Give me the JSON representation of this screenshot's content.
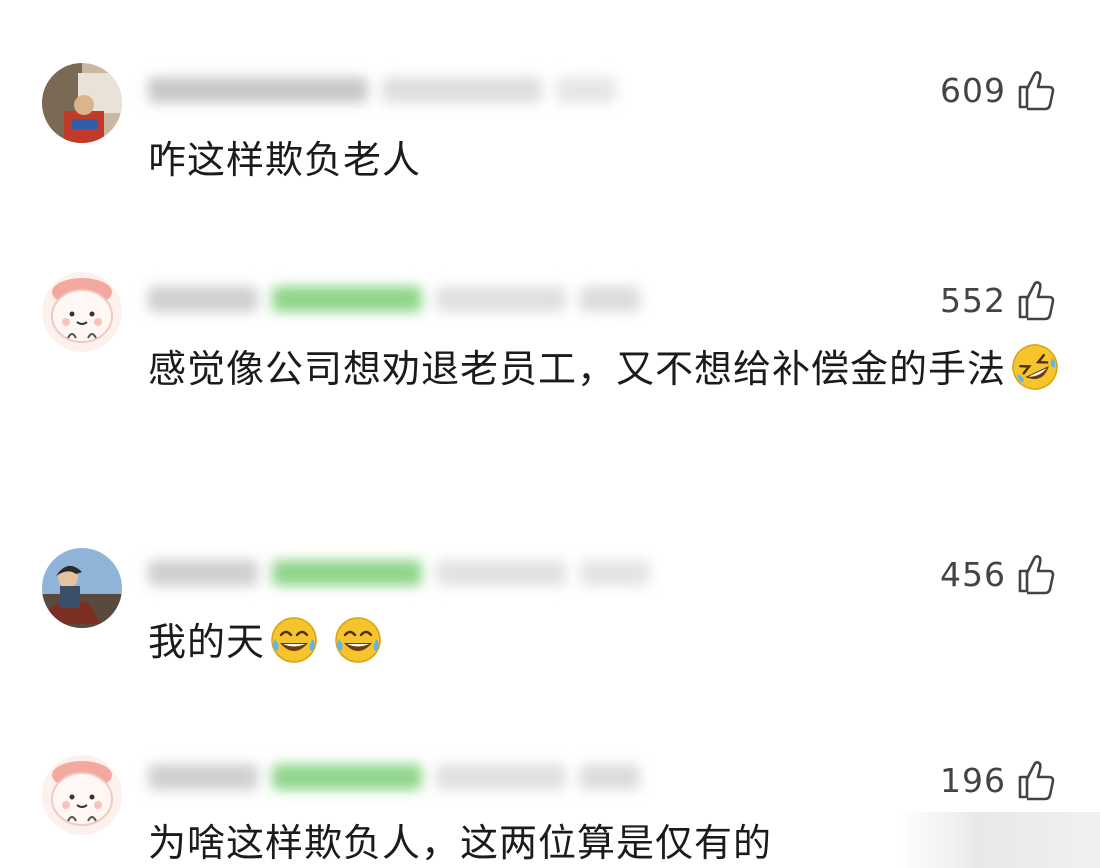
{
  "comments": [
    {
      "likes": "609",
      "text": "咋这样欺负老人",
      "avatar": "photo-avatar",
      "emojis": []
    },
    {
      "likes": "552",
      "text": "感觉像公司想劝退老员工，又不想给补偿金的手法",
      "avatar": "cartoon-bun-avatar",
      "emojis": [
        "rolling-laugh-emoji"
      ]
    },
    {
      "likes": "456",
      "text": "我的天",
      "avatar": "illustration-avatar",
      "emojis": [
        "tears-of-joy-emoji",
        "tears-of-joy-emoji"
      ]
    },
    {
      "likes": "196",
      "text": "为啥这样欺负人，这两位算是仅有的",
      "avatar": "cartoon-bun-avatar",
      "emojis": []
    }
  ],
  "icons": {
    "like": "thumbs-up-icon"
  },
  "colors": {
    "background": "#ffffff",
    "like_text": "#444444",
    "name_blur_green": "#8fd68a"
  }
}
